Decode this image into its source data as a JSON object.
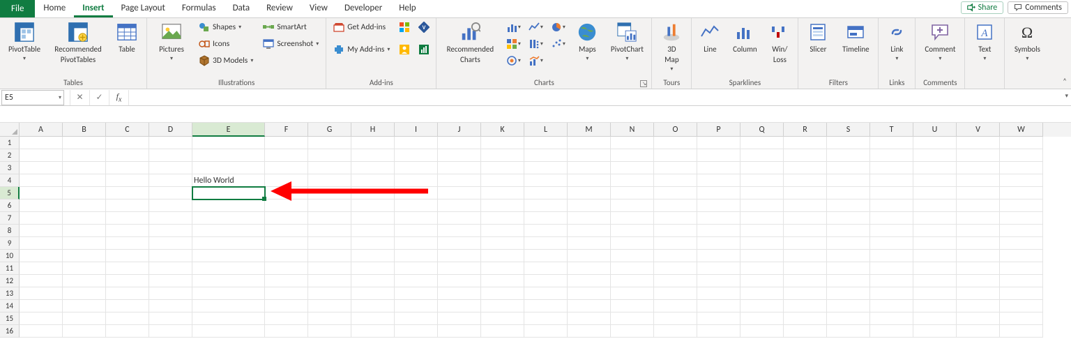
{
  "tabs": {
    "file": "File",
    "items": [
      "Home",
      "Insert",
      "Page Layout",
      "Formulas",
      "Data",
      "Review",
      "View",
      "Developer",
      "Help"
    ],
    "active": "Insert"
  },
  "topRight": {
    "share": "Share",
    "comments": "Comments"
  },
  "ribbon": {
    "tables": {
      "label": "Tables",
      "pivotTable": "PivotTable",
      "recommendedPivot_l1": "Recommended",
      "recommendedPivot_l2": "PivotTables",
      "table": "Table"
    },
    "illustrations": {
      "label": "Illustrations",
      "pictures": "Pictures",
      "shapes": "Shapes",
      "icons": "Icons",
      "models": "3D Models",
      "smartart": "SmartArt",
      "screenshot": "Screenshot"
    },
    "addins": {
      "label": "Add-ins",
      "get": "Get Add-ins",
      "my": "My Add-ins"
    },
    "charts": {
      "label": "Charts",
      "recommended_l1": "Recommended",
      "recommended_l2": "Charts",
      "maps": "Maps",
      "pivotChart": "PivotChart"
    },
    "tours": {
      "label": "Tours",
      "map_l1": "3D",
      "map_l2": "Map"
    },
    "sparklines": {
      "label": "Sparklines",
      "line": "Line",
      "column": "Column",
      "winloss_l1": "Win/",
      "winloss_l2": "Loss"
    },
    "filters": {
      "label": "Filters",
      "slicer": "Slicer",
      "timeline": "Timeline"
    },
    "links": {
      "label": "Links",
      "link": "Link"
    },
    "comments": {
      "label": "Comments",
      "comment": "Comment"
    },
    "text": {
      "label": "",
      "text": "Text"
    },
    "symbols": {
      "label": "",
      "symbols": "Symbols"
    }
  },
  "nameBox": "E5",
  "formula": "",
  "grid": {
    "columns": [
      "A",
      "B",
      "C",
      "D",
      "E",
      "F",
      "G",
      "H",
      "I",
      "J",
      "K",
      "L",
      "M",
      "N",
      "O",
      "P",
      "Q",
      "R",
      "S",
      "T",
      "U",
      "V",
      "W"
    ],
    "wideColumn": "E",
    "rowCount": 16,
    "activeCell": "E5",
    "activeCol": "E",
    "activeRow": 5,
    "cells": {
      "E4": "Hello World"
    }
  }
}
